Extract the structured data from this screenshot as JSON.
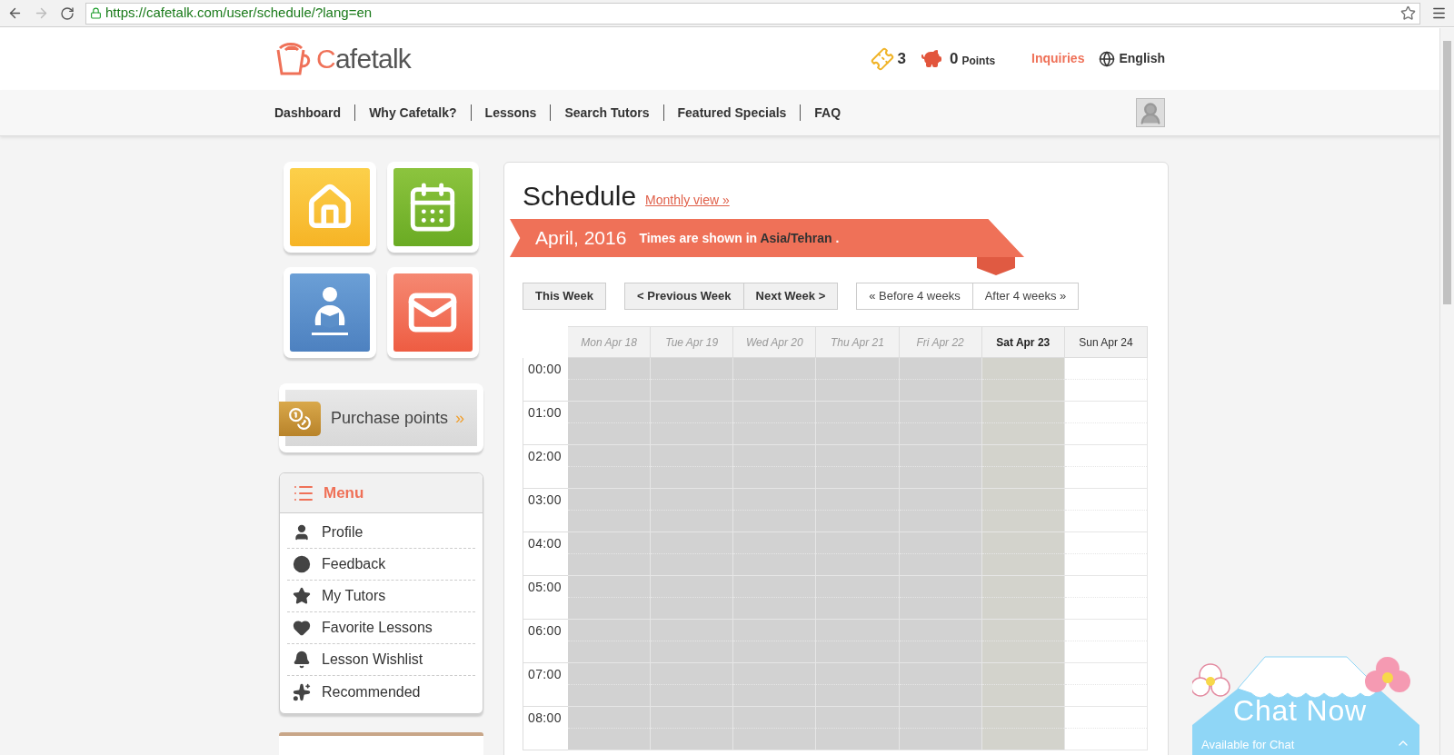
{
  "browser": {
    "url": "https://cafetalk.com/user/schedule/?lang=en"
  },
  "header": {
    "logo": "Cafetalk",
    "tickets": "3",
    "points_value": "0",
    "points_label": "Points",
    "inquiries": "Inquiries",
    "language": "English"
  },
  "nav": [
    "Dashboard",
    "Why Cafetalk?",
    "Lessons",
    "Search Tutors",
    "Featured Specials",
    "FAQ"
  ],
  "sidebar": {
    "purchase": "Purchase points",
    "purchase_arrow": "»",
    "menu_title": "Menu",
    "menu_items": [
      {
        "kind": "profile",
        "label": "Profile"
      },
      {
        "kind": "feedback",
        "label": "Feedback"
      },
      {
        "kind": "tutors",
        "label": "My Tutors"
      },
      {
        "kind": "favorites",
        "label": "Favorite Lessons"
      },
      {
        "kind": "wishlist",
        "label": "Lesson Wishlist"
      },
      {
        "kind": "recommended",
        "label": "Recommended"
      }
    ]
  },
  "schedule": {
    "title": "Schedule",
    "monthly_link": "Monthly view »",
    "month": "April, 2016",
    "tz_prefix": "Times are shown in",
    "tz": "Asia/Tehran",
    "tz_suffix": ".",
    "buttons": {
      "this_week": "This Week",
      "prev": "< Previous Week",
      "next": "Next Week >",
      "before": "« Before 4 weeks",
      "after": "After 4 weeks »"
    },
    "days": [
      {
        "label": "Mon Apr 18",
        "kind": "past"
      },
      {
        "label": "Tue Apr 19",
        "kind": "past"
      },
      {
        "label": "Wed Apr 20",
        "kind": "past"
      },
      {
        "label": "Thu Apr 21",
        "kind": "past"
      },
      {
        "label": "Fri Apr 22",
        "kind": "past"
      },
      {
        "label": "Sat Apr 23",
        "kind": "today"
      },
      {
        "label": "Sun Apr 24",
        "kind": "future"
      }
    ],
    "hours": [
      "00:00",
      "01:00",
      "02:00",
      "03:00",
      "04:00",
      "05:00",
      "06:00",
      "07:00",
      "08:00"
    ]
  },
  "chat": {
    "title": "Chat Now",
    "status": "Available for Chat"
  }
}
